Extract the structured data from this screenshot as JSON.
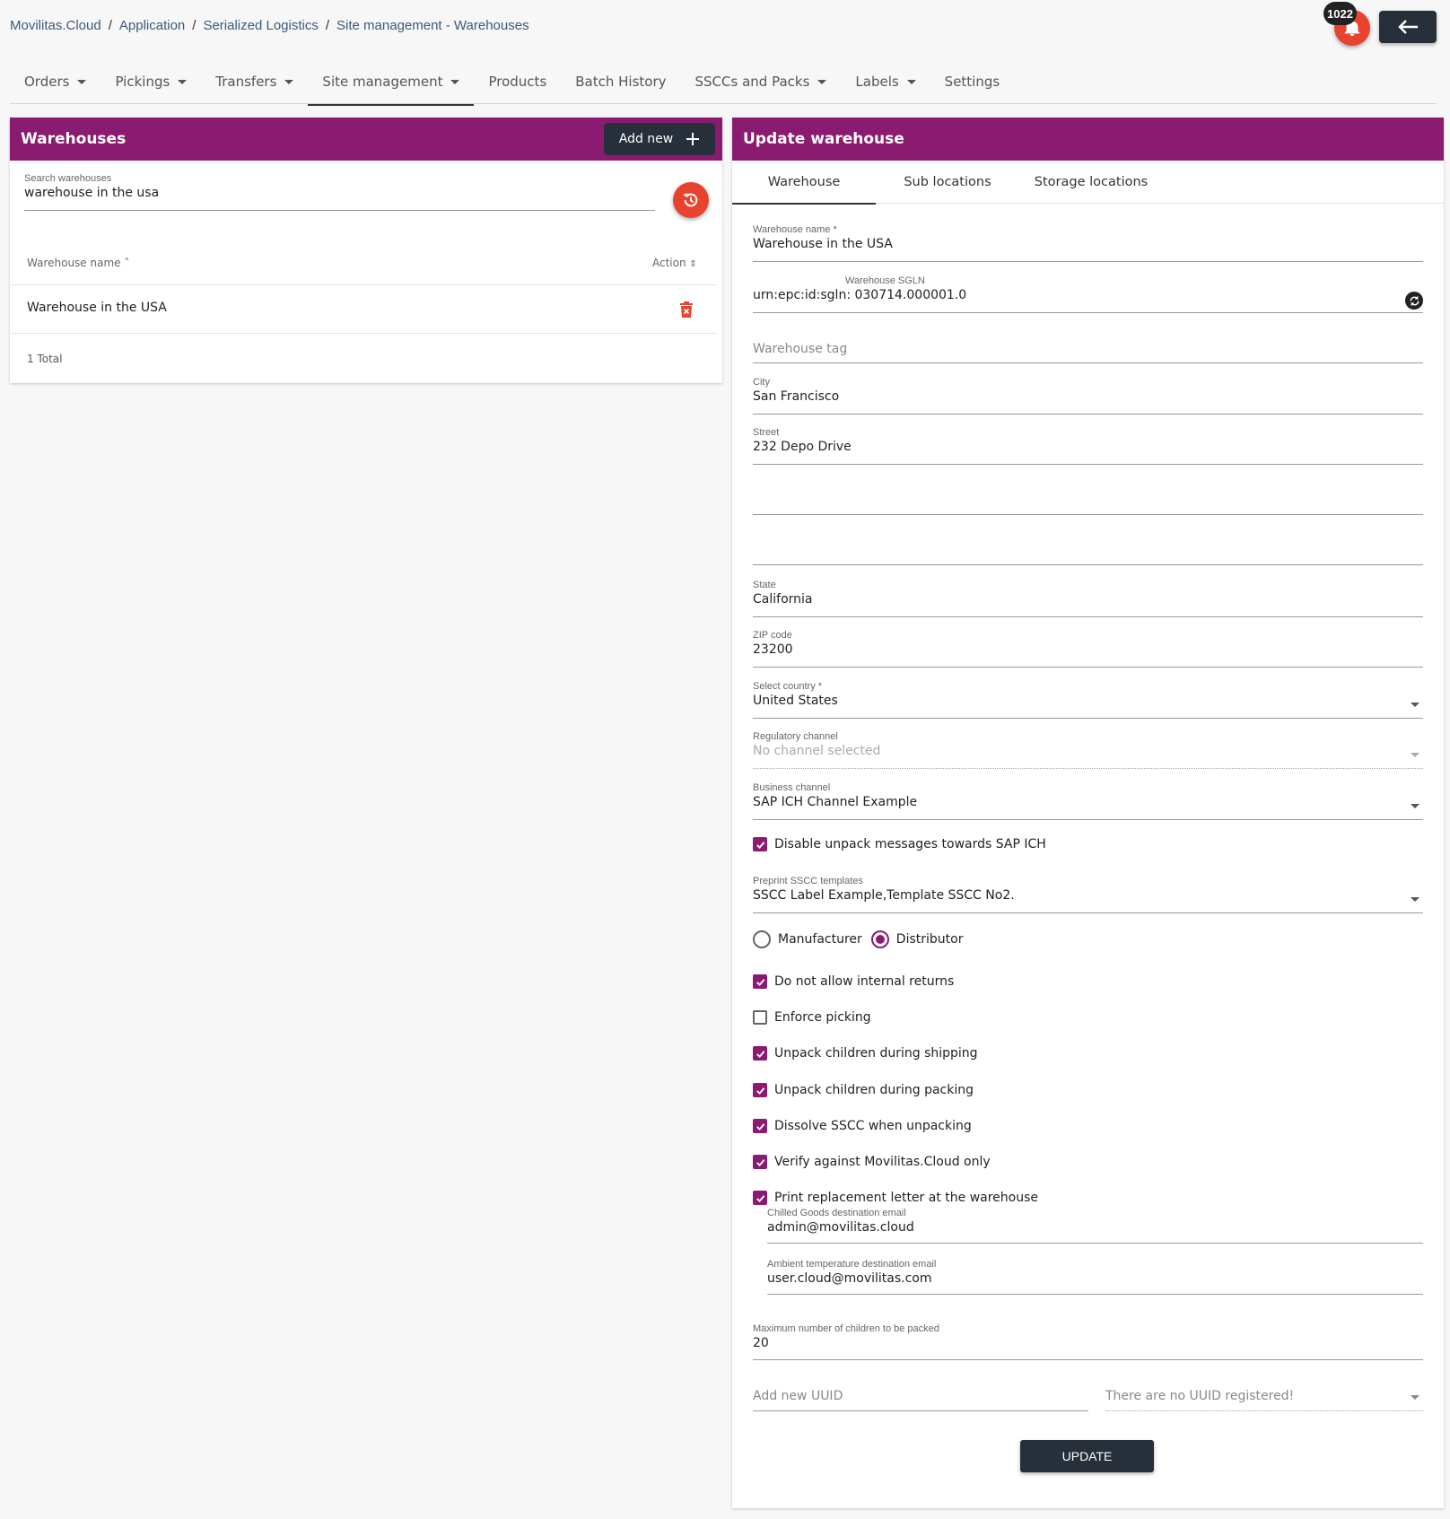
{
  "breadcrumb": [
    "Movilitas.Cloud",
    "Application",
    "Serialized Logistics",
    "Site management - Warehouses"
  ],
  "notifications": {
    "count": "1022"
  },
  "nav": [
    {
      "label": "Orders",
      "dropdown": true
    },
    {
      "label": "Pickings",
      "dropdown": true
    },
    {
      "label": "Transfers",
      "dropdown": true
    },
    {
      "label": "Site management",
      "dropdown": true,
      "active": true
    },
    {
      "label": "Products",
      "dropdown": false
    },
    {
      "label": "Batch History",
      "dropdown": false
    },
    {
      "label": "SSCCs and Packs",
      "dropdown": true
    },
    {
      "label": "Labels",
      "dropdown": true
    },
    {
      "label": "Settings",
      "dropdown": false
    }
  ],
  "warehouses": {
    "title": "Warehouses",
    "add_new": "Add new",
    "search_label": "Search warehouses",
    "search_value": "warehouse in the usa",
    "col_name": "Warehouse name",
    "col_action": "Action",
    "rows": [
      "Warehouse in the USA"
    ],
    "total": "1 Total"
  },
  "update": {
    "title": "Update warehouse",
    "tabs": [
      "Warehouse",
      "Sub locations",
      "Storage locations"
    ],
    "name_label": "Warehouse name *",
    "name_value": "Warehouse in the USA",
    "sgln_label": "Warehouse SGLN",
    "sgln_value": "urn:epc:id:sgln: 030714.000001.0",
    "tag_placeholder": "Warehouse tag",
    "city_label": "City",
    "city_value": "San Francisco",
    "street_label": "Street",
    "street_value": "232 Depo Drive",
    "state_label": "State",
    "state_value": "California",
    "zip_label": "ZIP code",
    "zip_value": "23200",
    "country_label": "Select country *",
    "country_value": "United States",
    "regulatory_label": "Regulatory channel",
    "regulatory_value": "No channel selected",
    "business_label": "Business channel",
    "business_value": "SAP ICH Channel Example",
    "disable_unpack": "Disable unpack messages towards SAP ICH",
    "preprint_label": "Preprint SSCC templates",
    "preprint_value": "SSCC Label Example,Template SSCC No2.",
    "radio_manufacturer": "Manufacturer",
    "radio_distributor": "Distributor",
    "cb_no_returns": "Do not allow internal returns",
    "cb_enforce": "Enforce picking",
    "cb_unpack_ship": "Unpack children during shipping",
    "cb_unpack_pack": "Unpack children during packing",
    "cb_dissolve": "Dissolve SSCC when unpacking",
    "cb_verify": "Verify against Movilitas.Cloud only",
    "cb_print": "Print replacement letter at the warehouse",
    "chilled_label": "Chilled Goods destination email",
    "chilled_value": "admin@movilitas.cloud",
    "ambient_label": "Ambient temperature destination email",
    "ambient_value": "user.cloud@movilitas.com",
    "max_label": "Maximum number of children to be packed",
    "max_value": "20",
    "uuid_placeholder": "Add new UUID",
    "uuid_select": "There are no UUID registered!",
    "update_button": "UPDATE"
  },
  "colors": {
    "brand": "#8b1b70",
    "dark": "#27303a",
    "red": "#e8432e"
  }
}
